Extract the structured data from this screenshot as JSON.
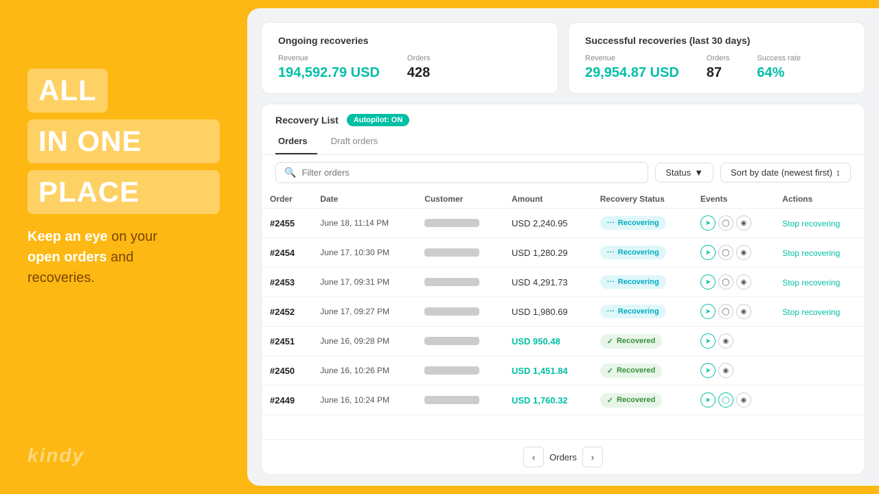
{
  "left": {
    "line1": "ALL",
    "line2": "IN ONE",
    "line3": "PLACE",
    "subtitle_part1": "Keep an eye",
    "subtitle_part2": " on your\nopen orders",
    "subtitle_part3": " and\nrecoveries.",
    "logo": "kindy"
  },
  "stats": {
    "ongoing": {
      "title": "Ongoing recoveries",
      "revenue_label": "Revenue",
      "revenue_value": "194,592.79 USD",
      "orders_label": "Orders",
      "orders_value": "428"
    },
    "successful": {
      "title": "Successful recoveries (last 30 days)",
      "revenue_label": "Revenue",
      "revenue_value": "29,954.87 USD",
      "orders_label": "Orders",
      "orders_value": "87",
      "success_rate_label": "Success rate",
      "success_rate_value": "64%"
    }
  },
  "recovery_list": {
    "title": "Recovery List",
    "autopilot_badge": "Autopilot: ON",
    "tab_orders": "Orders",
    "tab_draft": "Draft orders",
    "search_placeholder": "Filter orders",
    "status_filter": "Status",
    "sort_label": "Sort by date (newest first)",
    "columns": {
      "order": "Order",
      "date": "Date",
      "customer": "Customer",
      "amount": "Amount",
      "recovery_status": "Recovery Status",
      "events": "Events",
      "actions": "Actions"
    },
    "rows": [
      {
        "order": "#2455",
        "date": "June 18, 11:14 PM",
        "amount": "USD 2,240.95",
        "amount_teal": false,
        "status": "Recovering",
        "status_type": "recovering",
        "events": [
          "active",
          "inactive",
          "inactive"
        ],
        "action": "Stop recovering"
      },
      {
        "order": "#2454",
        "date": "June 17, 10:30 PM",
        "amount": "USD 1,280.29",
        "amount_teal": false,
        "status": "Recovering",
        "status_type": "recovering",
        "events": [
          "active",
          "inactive",
          "inactive"
        ],
        "action": "Stop recovering"
      },
      {
        "order": "#2453",
        "date": "June 17, 09:31 PM",
        "amount": "USD 4,291.73",
        "amount_teal": false,
        "status": "Recovering",
        "status_type": "recovering",
        "events": [
          "active",
          "inactive",
          "inactive"
        ],
        "action": "Stop recovering"
      },
      {
        "order": "#2452",
        "date": "June 17, 09:27 PM",
        "amount": "USD 1,980.69",
        "amount_teal": false,
        "status": "Recovering",
        "status_type": "recovering",
        "events": [
          "active",
          "inactive",
          "inactive"
        ],
        "action": "Stop recovering"
      },
      {
        "order": "#2451",
        "date": "June 16, 09:28 PM",
        "amount": "USD 950.48",
        "amount_teal": true,
        "status": "Recovered",
        "status_type": "recovered",
        "events": [
          "active",
          "inactive"
        ],
        "action": ""
      },
      {
        "order": "#2450",
        "date": "June 16, 10:26 PM",
        "amount": "USD 1,451.84",
        "amount_teal": true,
        "status": "Recovered",
        "status_type": "recovered",
        "events": [
          "active",
          "inactive"
        ],
        "action": ""
      },
      {
        "order": "#2449",
        "date": "June 16, 10:24 PM",
        "amount": "USD 1,760.32",
        "amount_teal": true,
        "status": "Recovered",
        "status_type": "recovered",
        "events": [
          "active",
          "active",
          "inactive"
        ],
        "action": ""
      }
    ],
    "pagination_label": "Orders"
  }
}
